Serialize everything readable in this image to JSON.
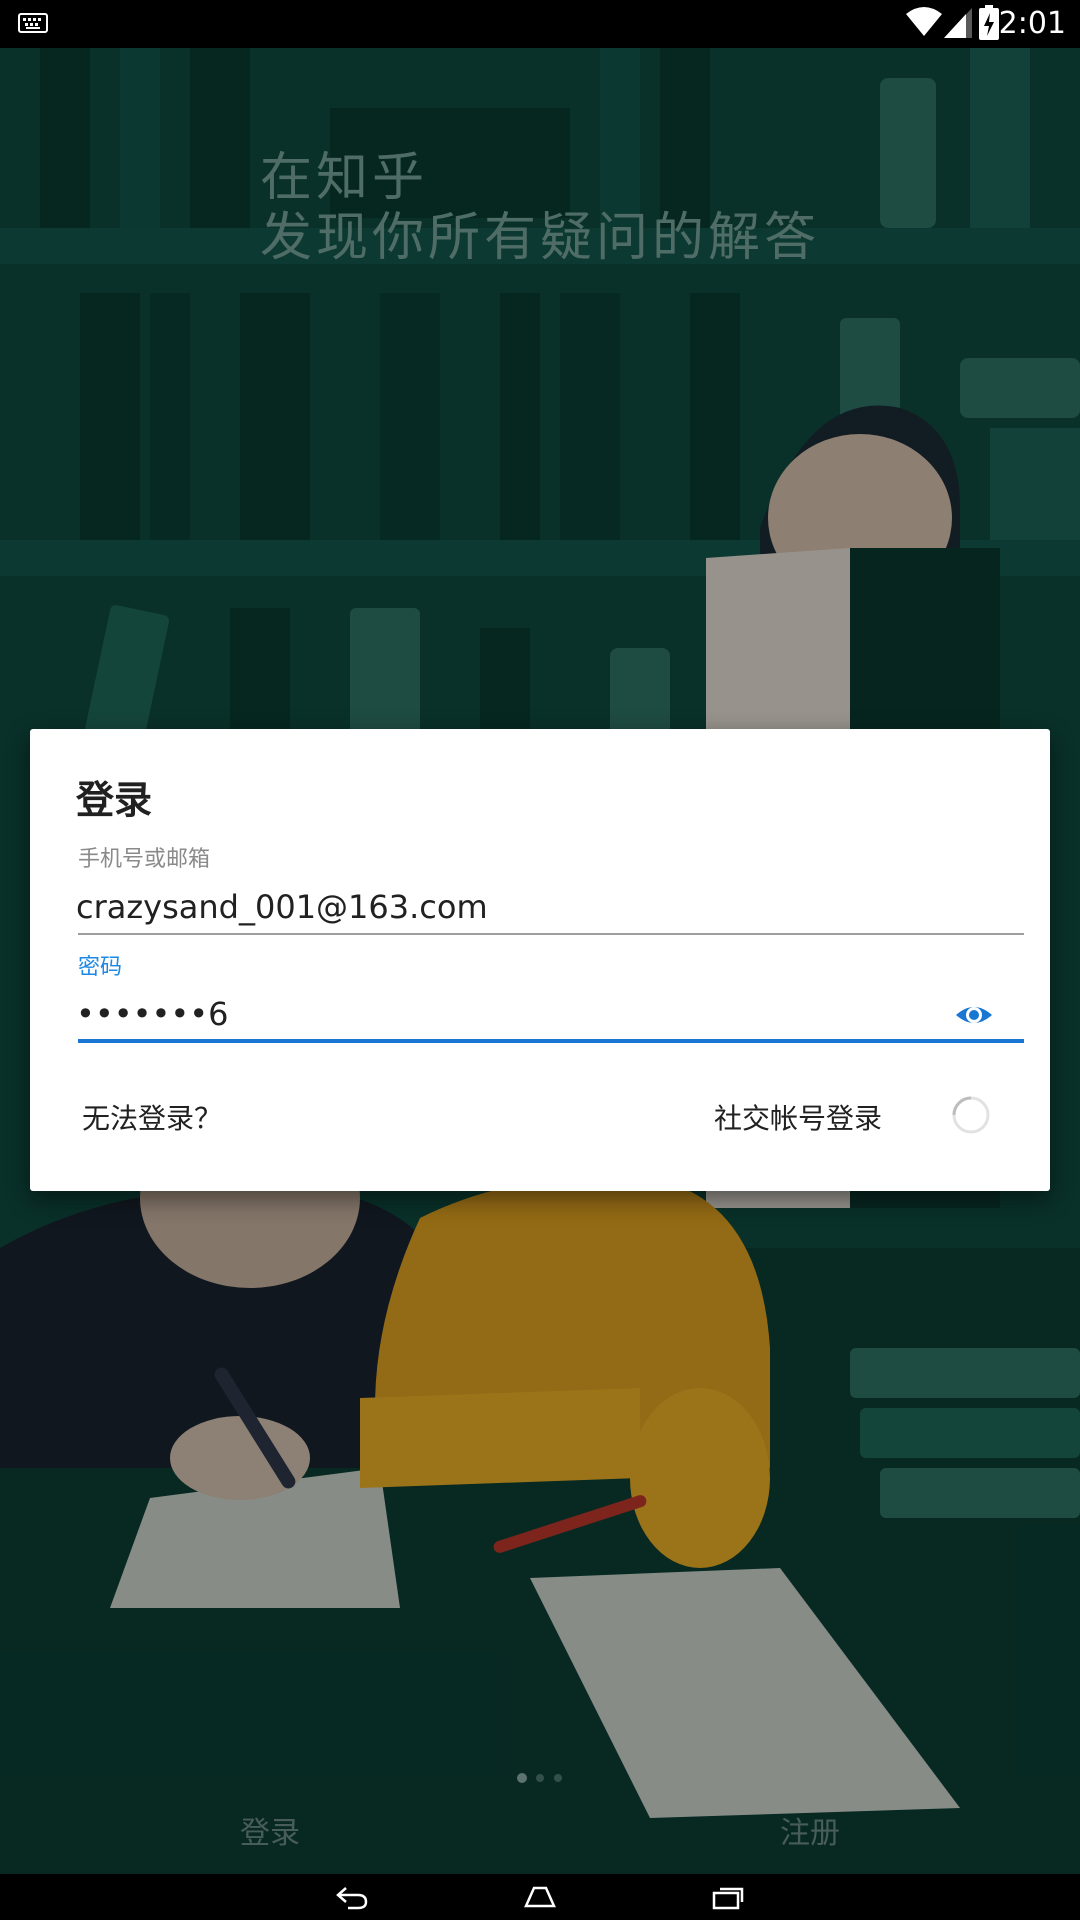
{
  "status_bar": {
    "time": "2:01",
    "icons": [
      "keyboard-icon",
      "wifi-icon",
      "signal-icon",
      "battery-charging-icon"
    ]
  },
  "background": {
    "tagline_line1": "在知乎",
    "tagline_line2": "发现你所有疑问的解答"
  },
  "dialog": {
    "title": "登录",
    "account": {
      "label": "手机号或邮箱",
      "value": "crazysand_001@163.com"
    },
    "password": {
      "label": "密码",
      "value": "•••••••6",
      "visibility_icon": "eye-icon"
    },
    "cannot_login_label": "无法登录？",
    "social_login_label": "社交帐号登录",
    "spinner_icon": "loading-spinner-icon"
  },
  "bottom": {
    "page_indicator": {
      "pages": 3,
      "current": 1
    },
    "login_tab": "登录",
    "register_tab": "注册"
  },
  "nav_bar": {
    "icons": [
      "back-icon",
      "home-icon",
      "recents-icon"
    ]
  },
  "colors": {
    "background": "#0d3f35",
    "accent": "#1976d2",
    "dialog": "#ffffff"
  }
}
